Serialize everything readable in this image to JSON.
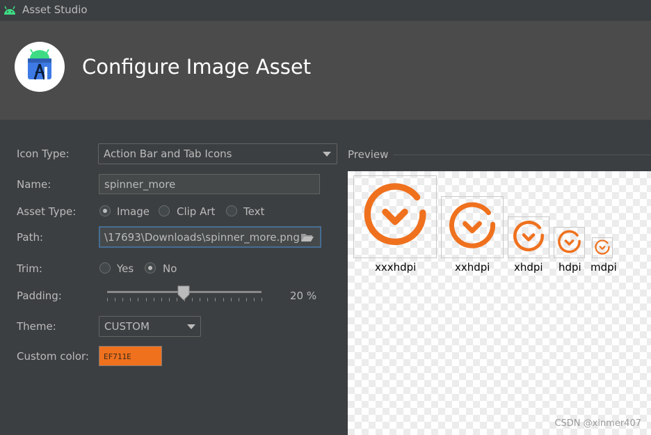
{
  "window": {
    "title": "Asset Studio"
  },
  "header": {
    "title": "Configure Image Asset"
  },
  "form": {
    "icon_type": {
      "label": "Icon Type:",
      "value": "Action Bar and Tab Icons"
    },
    "name": {
      "label": "Name:",
      "value": "spinner_more"
    },
    "asset_type": {
      "label": "Asset Type:",
      "options": [
        "Image",
        "Clip Art",
        "Text"
      ],
      "selected": "Image"
    },
    "path": {
      "label": "Path:",
      "value": "\\17693\\Downloads\\spinner_more.png"
    },
    "trim": {
      "label": "Trim:",
      "options": [
        "Yes",
        "No"
      ],
      "selected": "No"
    },
    "padding": {
      "label": "Padding:",
      "value": 20,
      "display": "20 %"
    },
    "theme": {
      "label": "Theme:",
      "value": "CUSTOM"
    },
    "custom_color": {
      "label": "Custom color:",
      "value": "EF711E",
      "hex": "#ef711e"
    }
  },
  "preview": {
    "label": "Preview",
    "densities": [
      "xxxhdpi",
      "xxhdpi",
      "xhdpi",
      "hdpi",
      "mdpi"
    ],
    "icon_color": "#ef711e"
  },
  "watermark": "CSDN @xinmer407",
  "icons": {
    "app": "android-icon",
    "logo": "android-studio-logo",
    "browse": "folder-open-icon",
    "dropdown": "chevron-down-icon",
    "preview": "chevron-circle-down-icon"
  }
}
